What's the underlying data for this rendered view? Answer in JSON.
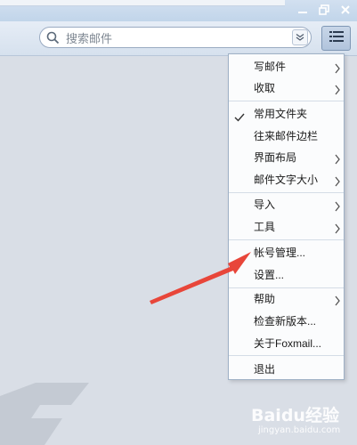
{
  "search": {
    "placeholder": "搜索邮件"
  },
  "menu": {
    "items": [
      {
        "label": "写邮件",
        "submenu": true
      },
      {
        "label": "收取",
        "submenu": true
      },
      {
        "label": "常用文件夹",
        "checked": true
      },
      {
        "label": "往来邮件边栏"
      },
      {
        "label": "界面布局",
        "submenu": true
      },
      {
        "label": "邮件文字大小",
        "submenu": true
      },
      {
        "label": "导入",
        "submenu": true
      },
      {
        "label": "工具",
        "submenu": true
      },
      {
        "label": "帐号管理..."
      },
      {
        "label": "设置..."
      },
      {
        "label": "帮助",
        "submenu": true
      },
      {
        "label": "检查新版本..."
      },
      {
        "label": "关于Foxmail..."
      },
      {
        "label": "退出"
      }
    ]
  },
  "watermark": {
    "text": "Baidu经验",
    "url": "jingyan.baidu.com"
  },
  "colors": {
    "annotation_arrow": "#e8463a",
    "toolbar": "#dbe5f1",
    "content_bg": "#d9dee6"
  },
  "icons": [
    "minimize-icon",
    "restore-icon",
    "close-icon",
    "search-icon",
    "chevron-down-icon",
    "hamburger-menu-icon",
    "checkmark-icon",
    "chevron-right-icon"
  ]
}
